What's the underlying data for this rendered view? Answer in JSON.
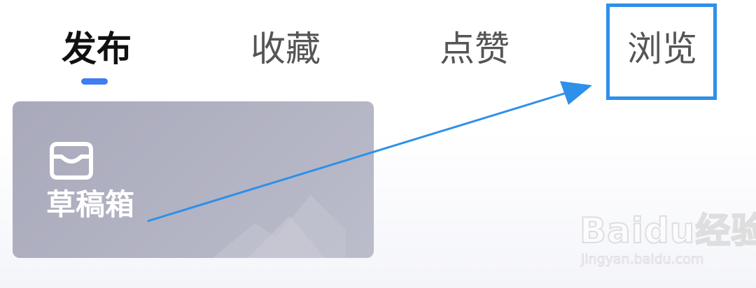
{
  "tabs": [
    {
      "label": "发布",
      "active": true
    },
    {
      "label": "收藏",
      "active": false
    },
    {
      "label": "点赞",
      "active": false
    },
    {
      "label": "浏览",
      "active": false
    }
  ],
  "highlighted_tab": "浏览",
  "draft_card": {
    "icon": "inbox-icon",
    "label": "草稿箱"
  },
  "watermark": {
    "logo_text": "Baidu经验",
    "url": "jingyan.baidu.com"
  },
  "colors": {
    "accent": "#3f7df1",
    "annotation": "#2e90e8",
    "card_background": "#acadbe",
    "active_tab_text": "#111111",
    "inactive_tab_text": "#555555"
  }
}
